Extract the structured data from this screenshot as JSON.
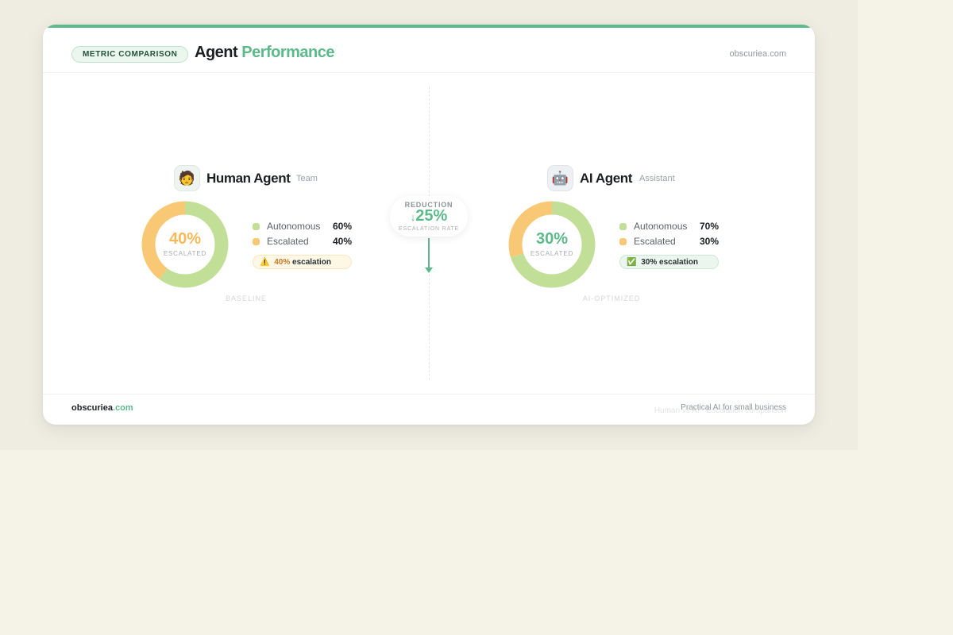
{
  "header": {
    "badge": "METRIC COMPARISON",
    "title_main": "Agent",
    "title_accent": "Performance",
    "brand": "obscuriea.com"
  },
  "colors": {
    "accent": "#5cb98a",
    "autonomous": "#c2df98",
    "escalated": "#f8c874",
    "human_value": "#f5b95a",
    "ai_value": "#5cb98a"
  },
  "human": {
    "icon": "person-emoji-icon",
    "avatar": "🧑",
    "name": "Human Agent",
    "subtitle": "Team",
    "center_value": "40%",
    "center_caption": "ESCALATED",
    "legend": [
      {
        "label": "Autonomous",
        "value": "60%"
      },
      {
        "label": "Escalated",
        "value": "40%"
      }
    ],
    "pill_icon": "⚠️",
    "pill_value": "40%",
    "pill_text": "escalation",
    "footer_label": "BASELINE"
  },
  "ai": {
    "icon": "robot-emoji-icon",
    "avatar": "🤖",
    "name": "AI Agent",
    "subtitle": "Assistant",
    "center_value": "30%",
    "center_caption": "ESCALATED",
    "legend": [
      {
        "label": "Autonomous",
        "value": "70%"
      },
      {
        "label": "Escalated",
        "value": "30%"
      }
    ],
    "pill_icon": "✅",
    "pill_value": "30%",
    "pill_text": "escalation",
    "footer_label": "AI-OPTIMIZED"
  },
  "reduction": {
    "caption": "REDUCTION",
    "arrow": "↓",
    "value": "25%",
    "subcaption": "ESCALATION RATE"
  },
  "footer": {
    "brand_name": "obscuriea",
    "brand_tld": ".com",
    "ghost_text": "Human vs AI · Escalation comparison",
    "tagline": "Practical AI for small business"
  },
  "chart_data": [
    {
      "type": "pie",
      "title": "Human Agent",
      "categories": [
        "Autonomous",
        "Escalated"
      ],
      "values": [
        60,
        40
      ]
    },
    {
      "type": "pie",
      "title": "AI Agent",
      "categories": [
        "Autonomous",
        "Escalated"
      ],
      "values": [
        70,
        30
      ]
    }
  ]
}
